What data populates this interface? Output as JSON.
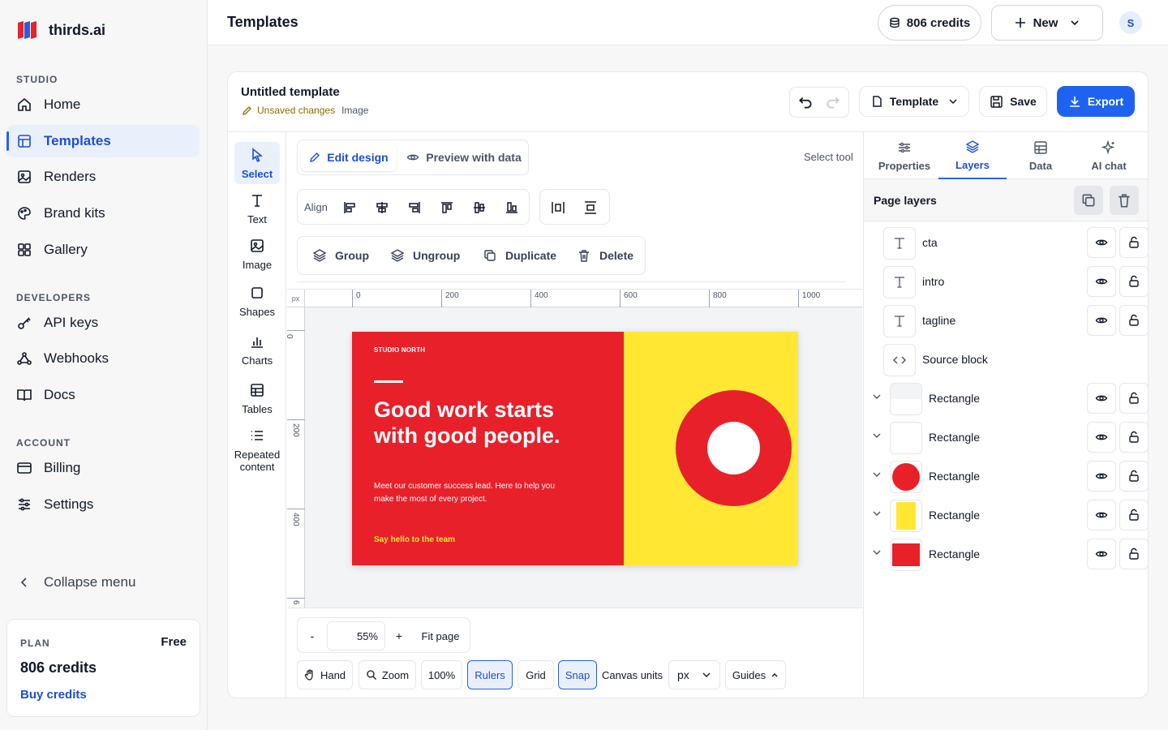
{
  "brand": {
    "name": "thirds.ai"
  },
  "sidebar": {
    "sections": [
      {
        "label": "STUDIO"
      },
      {
        "label": "DEVELOPERS"
      },
      {
        "label": "ACCOUNT"
      }
    ],
    "items": [
      {
        "label": "Home",
        "icon": "home-icon"
      },
      {
        "label": "Templates",
        "icon": "template-icon",
        "active": true
      },
      {
        "label": "Renders",
        "icon": "image-icon"
      },
      {
        "label": "Brand kits",
        "icon": "palette-icon"
      },
      {
        "label": "Gallery",
        "icon": "grid-icon"
      },
      {
        "label": "API keys",
        "icon": "key-icon"
      },
      {
        "label": "Webhooks",
        "icon": "webhook-icon"
      },
      {
        "label": "Docs",
        "icon": "book-icon"
      },
      {
        "label": "Billing",
        "icon": "card-icon"
      },
      {
        "label": "Settings",
        "icon": "sliders-icon"
      }
    ],
    "collapse": "Collapse menu",
    "plan": {
      "label": "PLAN",
      "tier": "Free",
      "credits": "806 credits",
      "buy": "Buy credits"
    }
  },
  "topbar": {
    "title": "Templates",
    "credits": "806 credits",
    "new_label": "New",
    "avatar": "S"
  },
  "editor": {
    "template_name": "Untitled template",
    "unsaved": "Unsaved changes",
    "type": "Image",
    "template_btn": "Template",
    "save": "Save",
    "export": "Export",
    "tools": [
      "Select",
      "Text",
      "Image",
      "Shapes",
      "Charts",
      "Tables",
      "Repeated content"
    ],
    "modes": {
      "edit": "Edit design",
      "preview": "Preview with data"
    },
    "status": "Select tool",
    "align_label": "Align",
    "actions": {
      "group": "Group",
      "ungroup": "Ungroup",
      "duplicate": "Duplicate",
      "delete": "Delete"
    },
    "ruler": {
      "unit": "px",
      "h_ticks": [
        "0",
        "200",
        "400",
        "600",
        "800",
        "1000"
      ],
      "v_ticks": [
        "0",
        "200",
        "400",
        "6"
      ]
    },
    "zoom": {
      "minus": "-",
      "value": "55%",
      "plus": "+",
      "fit": "Fit page"
    },
    "bottom": {
      "hand": "Hand",
      "zoom": "Zoom",
      "hundred": "100%",
      "rulers": "Rulers",
      "grid": "Grid",
      "snap": "Snap",
      "canvas_units_label": "Canvas units",
      "units_value": "px",
      "guides": "Guides"
    }
  },
  "canvas_design": {
    "kicker": "STUDIO NORTH",
    "headline_1": "Good work starts",
    "headline_2": "with good people.",
    "body_1": "Meet our customer success lead. Here to help you",
    "body_2": "make the most of every project.",
    "cta": "Say hello to the team",
    "colors": {
      "red": "#e8202a",
      "yellow": "#ffe733"
    }
  },
  "right_panel": {
    "tabs": [
      "Properties",
      "Layers",
      "Data",
      "AI chat"
    ],
    "active_tab": "Layers",
    "page_layers": "Page layers",
    "layers": [
      {
        "name": "cta",
        "kind": "text"
      },
      {
        "name": "intro",
        "kind": "text"
      },
      {
        "name": "tagline",
        "kind": "text"
      },
      {
        "name": "Source block",
        "kind": "code"
      },
      {
        "name": "Rectangle",
        "kind": "rect-light"
      },
      {
        "name": "Rectangle",
        "kind": "rect-white"
      },
      {
        "name": "Rectangle",
        "kind": "circle-red"
      },
      {
        "name": "Rectangle",
        "kind": "rect-yellow"
      },
      {
        "name": "Rectangle",
        "kind": "rect-red"
      }
    ]
  },
  "accent": "#2563eb"
}
